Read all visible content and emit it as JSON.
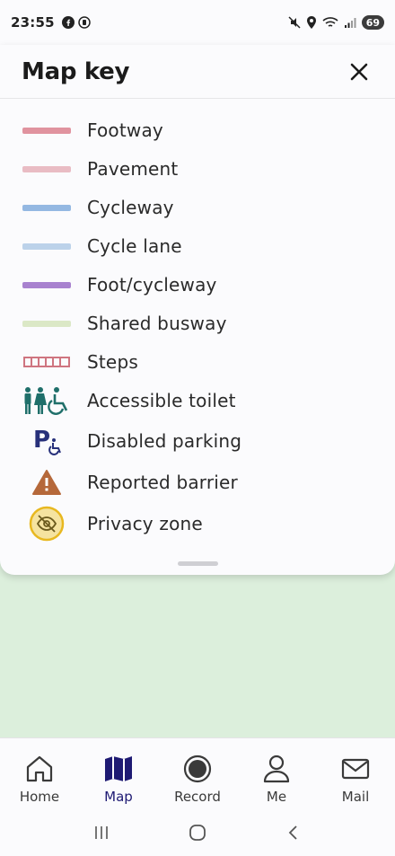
{
  "status_bar": {
    "time": "23:55",
    "battery": "69",
    "icons": [
      "facebook-icon",
      "media-icon",
      "mute-icon",
      "location-icon",
      "wifi-icon",
      "signal-icon",
      "battery-icon"
    ]
  },
  "sheet": {
    "title": "Map key",
    "close_icon": "close-icon"
  },
  "key_items": [
    {
      "label": "Footway",
      "symbol": "line",
      "color": "#e0939f"
    },
    {
      "label": "Pavement",
      "symbol": "line",
      "color": "#e9bcc4"
    },
    {
      "label": "Cycleway",
      "symbol": "line",
      "color": "#94b8e2"
    },
    {
      "label": "Cycle lane",
      "symbol": "line",
      "color": "#bcd2ea"
    },
    {
      "label": "Foot/cycleway",
      "symbol": "line",
      "color": "#a882cf"
    },
    {
      "label": "Shared busway",
      "symbol": "line",
      "color": "#dbe8c6"
    },
    {
      "label": "Steps",
      "symbol": "steps",
      "color": "#cf7580"
    },
    {
      "label": "Accessible toilet",
      "symbol": "toilet",
      "color": "#1f6f6a"
    },
    {
      "label": "Disabled parking",
      "symbol": "parking",
      "color": "#27307a"
    },
    {
      "label": "Reported barrier",
      "symbol": "warning",
      "color": "#b5683a"
    },
    {
      "label": "Privacy zone",
      "symbol": "privacy",
      "color": "#e8b820"
    }
  ],
  "bottom_nav": [
    {
      "label": "Home",
      "icon": "home-icon",
      "active": false
    },
    {
      "label": "Map",
      "icon": "map-icon",
      "active": true
    },
    {
      "label": "Record",
      "icon": "record-icon",
      "active": false
    },
    {
      "label": "Me",
      "icon": "person-icon",
      "active": false
    },
    {
      "label": "Mail",
      "icon": "mail-icon",
      "active": false
    }
  ],
  "colors": {
    "accent": "#1e1a73",
    "map_background": "#dcefdc"
  }
}
